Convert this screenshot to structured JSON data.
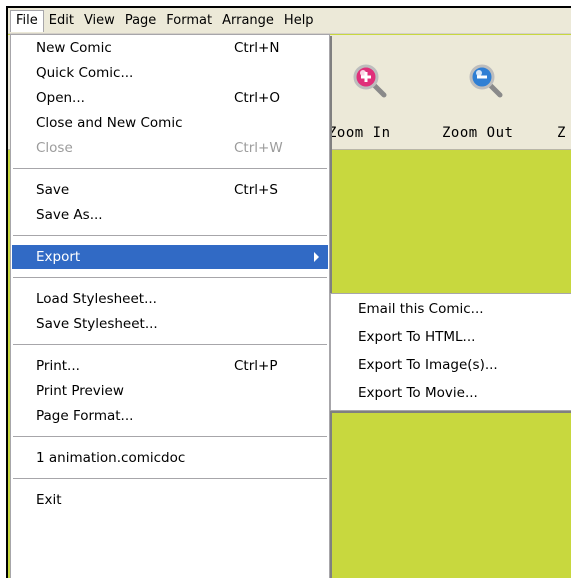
{
  "menubar": {
    "items": [
      "File",
      "Edit",
      "View",
      "Page",
      "Format",
      "Arrange",
      "Help"
    ]
  },
  "toolbar": {
    "zoom_in_label": "Zoom In",
    "zoom_out_label": "Zoom Out",
    "truncated_label": "Z"
  },
  "file_menu": {
    "new_comic": {
      "label": "New Comic",
      "shortcut": "Ctrl+N"
    },
    "quick_comic": {
      "label": "Quick Comic..."
    },
    "open": {
      "label": "Open...",
      "shortcut": "Ctrl+O"
    },
    "close_and_new": {
      "label": "Close and New Comic"
    },
    "close": {
      "label": "Close",
      "shortcut": "Ctrl+W"
    },
    "save": {
      "label": "Save",
      "shortcut": "Ctrl+S"
    },
    "save_as": {
      "label": "Save As..."
    },
    "export": {
      "label": "Export"
    },
    "load_stylesheet": {
      "label": "Load Stylesheet..."
    },
    "save_stylesheet": {
      "label": "Save Stylesheet..."
    },
    "print": {
      "label": "Print...",
      "shortcut": "Ctrl+P"
    },
    "print_preview": {
      "label": "Print Preview"
    },
    "page_format": {
      "label": "Page Format..."
    },
    "recent_1": {
      "label": "1 animation.comicdoc"
    },
    "exit": {
      "label": "Exit"
    }
  },
  "export_submenu": {
    "email": "Email this Comic...",
    "html": "Export To HTML...",
    "image": "Export To Image(s)...",
    "movie": "Export To Movie..."
  },
  "colors": {
    "canvas": "#c8d83e",
    "menubar": "#ece9d8",
    "selection": "#316ac5",
    "zoom_in": "#e0307a",
    "zoom_out": "#2f7fd4"
  },
  "icons": {
    "zoom_in": "zoom-in-magnifier-icon",
    "zoom_out": "zoom-out-magnifier-icon",
    "submenu_arrow": "chevron-right-icon"
  }
}
